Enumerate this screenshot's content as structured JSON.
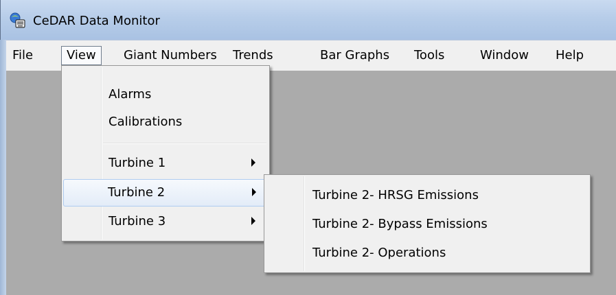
{
  "window": {
    "title": "CeDAR Data Monitor",
    "icon": "cedar-app-icon"
  },
  "menubar": {
    "items": [
      {
        "label": "File"
      },
      {
        "label": "View"
      },
      {
        "label": "Giant Numbers"
      },
      {
        "label": "Trends"
      },
      {
        "label": "Bar Graphs"
      },
      {
        "label": "Tools"
      },
      {
        "label": "Window"
      },
      {
        "label": "Help"
      }
    ],
    "open_menu": "View"
  },
  "view_menu": {
    "items": [
      {
        "label": "Alarms",
        "submenu": false
      },
      {
        "label": "Calibrations",
        "submenu": false
      },
      {
        "label": "Turbine 1",
        "submenu": true
      },
      {
        "label": "Turbine 2",
        "submenu": true,
        "highlighted": true
      },
      {
        "label": "Turbine 3",
        "submenu": true
      }
    ]
  },
  "turbine2_submenu": {
    "items": [
      {
        "label": "Turbine 2- HRSG Emissions"
      },
      {
        "label": "Turbine 2- Bypass Emissions"
      },
      {
        "label": "Turbine 2- Operations"
      }
    ]
  },
  "colors": {
    "mdi_background": "#ababab",
    "menu_background": "#f0f0f0",
    "highlight_border": "#aecbf0"
  }
}
